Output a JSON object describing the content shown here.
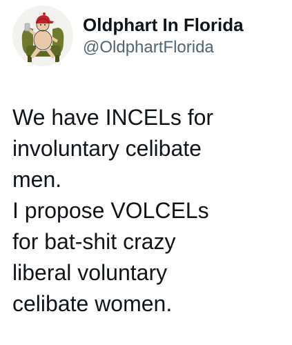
{
  "author": {
    "display_name": "Oldphart In Florida",
    "handle": "@OldphartFlorida",
    "avatar_icon": "cartoon-old-man-in-armchair-avatar"
  },
  "tweet": {
    "lines": [
      "We have INCELs for",
      "involuntary celibate",
      "men.",
      "I propose VOLCELs",
      "for bat-shit crazy",
      "liberal voluntary",
      "celibate women."
    ]
  },
  "colors": {
    "text_primary": "#0f1419",
    "text_secondary": "#536471",
    "background": "#ffffff"
  }
}
